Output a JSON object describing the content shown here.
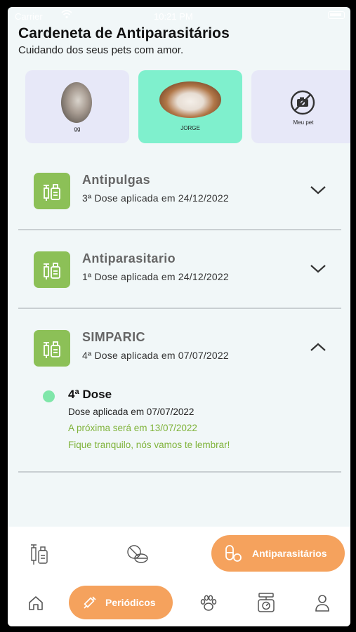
{
  "status_bar": {
    "carrier": "Carrier",
    "time": "10:21 PM"
  },
  "header": {
    "title": "Cardeneta de Antiparasitários",
    "subtitle": "Cuidando dos seus pets com amor."
  },
  "pets": [
    {
      "name": "gg",
      "selected": false
    },
    {
      "name": "JORGE",
      "selected": true
    },
    {
      "name": "Meu pet",
      "selected": false
    }
  ],
  "treatments": [
    {
      "name": "Antipulgas",
      "dose_text": "3ª Dose aplicada em 24/12/2022",
      "expanded": false
    },
    {
      "name": "Antiparasitario",
      "dose_text": "1ª Dose aplicada em 24/12/2022",
      "expanded": false
    },
    {
      "name": "SIMPARIC",
      "dose_text": "4ª Dose aplicada em 07/07/2022",
      "expanded": true
    }
  ],
  "detail": {
    "title": "4ª Dose",
    "applied": "Dose aplicada em 07/07/2022",
    "next": "A próxima será em 13/07/2022",
    "reminder": "Fique tranquilo, nós vamos te lembrar!"
  },
  "sub_tabs": {
    "vaccine_icon": "syringe-bottle-icon",
    "pills_icon": "pills-icon",
    "active_label": "Antiparasitários"
  },
  "bottom_nav": {
    "home_icon": "home-icon",
    "active_label": "Periódicos",
    "paw_icon": "paw-icon",
    "scale_icon": "scale-icon",
    "profile_icon": "profile-icon"
  },
  "colors": {
    "accent_orange": "#f5a25d",
    "selected_pet": "#7ff0cd",
    "pet_card": "#e7e8f8",
    "med_icon": "#8cc057",
    "next_dose_green": "#7fb33a",
    "dose_dot": "#7fe6a9"
  }
}
